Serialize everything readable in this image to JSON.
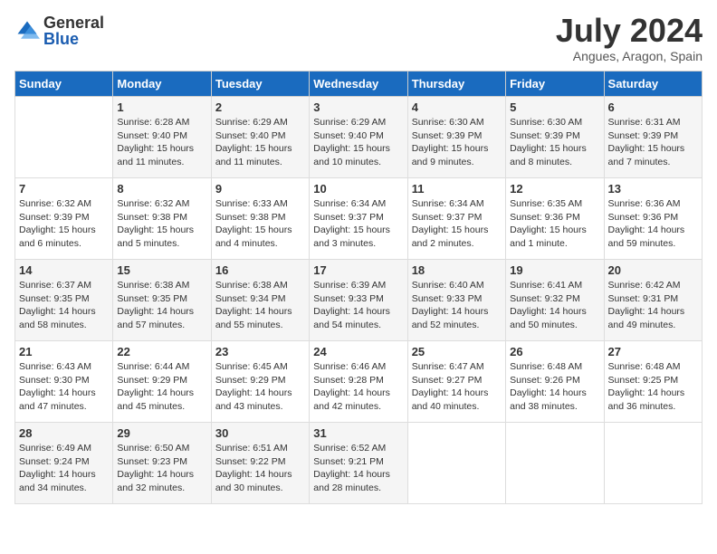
{
  "logo": {
    "general": "General",
    "blue": "Blue"
  },
  "title": "July 2024",
  "location": "Angues, Aragon, Spain",
  "days_of_week": [
    "Sunday",
    "Monday",
    "Tuesday",
    "Wednesday",
    "Thursday",
    "Friday",
    "Saturday"
  ],
  "weeks": [
    [
      {
        "day": "",
        "info": ""
      },
      {
        "day": "1",
        "info": "Sunrise: 6:28 AM\nSunset: 9:40 PM\nDaylight: 15 hours\nand 11 minutes."
      },
      {
        "day": "2",
        "info": "Sunrise: 6:29 AM\nSunset: 9:40 PM\nDaylight: 15 hours\nand 11 minutes."
      },
      {
        "day": "3",
        "info": "Sunrise: 6:29 AM\nSunset: 9:40 PM\nDaylight: 15 hours\nand 10 minutes."
      },
      {
        "day": "4",
        "info": "Sunrise: 6:30 AM\nSunset: 9:39 PM\nDaylight: 15 hours\nand 9 minutes."
      },
      {
        "day": "5",
        "info": "Sunrise: 6:30 AM\nSunset: 9:39 PM\nDaylight: 15 hours\nand 8 minutes."
      },
      {
        "day": "6",
        "info": "Sunrise: 6:31 AM\nSunset: 9:39 PM\nDaylight: 15 hours\nand 7 minutes."
      }
    ],
    [
      {
        "day": "7",
        "info": "Sunrise: 6:32 AM\nSunset: 9:39 PM\nDaylight: 15 hours\nand 6 minutes."
      },
      {
        "day": "8",
        "info": "Sunrise: 6:32 AM\nSunset: 9:38 PM\nDaylight: 15 hours\nand 5 minutes."
      },
      {
        "day": "9",
        "info": "Sunrise: 6:33 AM\nSunset: 9:38 PM\nDaylight: 15 hours\nand 4 minutes."
      },
      {
        "day": "10",
        "info": "Sunrise: 6:34 AM\nSunset: 9:37 PM\nDaylight: 15 hours\nand 3 minutes."
      },
      {
        "day": "11",
        "info": "Sunrise: 6:34 AM\nSunset: 9:37 PM\nDaylight: 15 hours\nand 2 minutes."
      },
      {
        "day": "12",
        "info": "Sunrise: 6:35 AM\nSunset: 9:36 PM\nDaylight: 15 hours\nand 1 minute."
      },
      {
        "day": "13",
        "info": "Sunrise: 6:36 AM\nSunset: 9:36 PM\nDaylight: 14 hours\nand 59 minutes."
      }
    ],
    [
      {
        "day": "14",
        "info": "Sunrise: 6:37 AM\nSunset: 9:35 PM\nDaylight: 14 hours\nand 58 minutes."
      },
      {
        "day": "15",
        "info": "Sunrise: 6:38 AM\nSunset: 9:35 PM\nDaylight: 14 hours\nand 57 minutes."
      },
      {
        "day": "16",
        "info": "Sunrise: 6:38 AM\nSunset: 9:34 PM\nDaylight: 14 hours\nand 55 minutes."
      },
      {
        "day": "17",
        "info": "Sunrise: 6:39 AM\nSunset: 9:33 PM\nDaylight: 14 hours\nand 54 minutes."
      },
      {
        "day": "18",
        "info": "Sunrise: 6:40 AM\nSunset: 9:33 PM\nDaylight: 14 hours\nand 52 minutes."
      },
      {
        "day": "19",
        "info": "Sunrise: 6:41 AM\nSunset: 9:32 PM\nDaylight: 14 hours\nand 50 minutes."
      },
      {
        "day": "20",
        "info": "Sunrise: 6:42 AM\nSunset: 9:31 PM\nDaylight: 14 hours\nand 49 minutes."
      }
    ],
    [
      {
        "day": "21",
        "info": "Sunrise: 6:43 AM\nSunset: 9:30 PM\nDaylight: 14 hours\nand 47 minutes."
      },
      {
        "day": "22",
        "info": "Sunrise: 6:44 AM\nSunset: 9:29 PM\nDaylight: 14 hours\nand 45 minutes."
      },
      {
        "day": "23",
        "info": "Sunrise: 6:45 AM\nSunset: 9:29 PM\nDaylight: 14 hours\nand 43 minutes."
      },
      {
        "day": "24",
        "info": "Sunrise: 6:46 AM\nSunset: 9:28 PM\nDaylight: 14 hours\nand 42 minutes."
      },
      {
        "day": "25",
        "info": "Sunrise: 6:47 AM\nSunset: 9:27 PM\nDaylight: 14 hours\nand 40 minutes."
      },
      {
        "day": "26",
        "info": "Sunrise: 6:48 AM\nSunset: 9:26 PM\nDaylight: 14 hours\nand 38 minutes."
      },
      {
        "day": "27",
        "info": "Sunrise: 6:48 AM\nSunset: 9:25 PM\nDaylight: 14 hours\nand 36 minutes."
      }
    ],
    [
      {
        "day": "28",
        "info": "Sunrise: 6:49 AM\nSunset: 9:24 PM\nDaylight: 14 hours\nand 34 minutes."
      },
      {
        "day": "29",
        "info": "Sunrise: 6:50 AM\nSunset: 9:23 PM\nDaylight: 14 hours\nand 32 minutes."
      },
      {
        "day": "30",
        "info": "Sunrise: 6:51 AM\nSunset: 9:22 PM\nDaylight: 14 hours\nand 30 minutes."
      },
      {
        "day": "31",
        "info": "Sunrise: 6:52 AM\nSunset: 9:21 PM\nDaylight: 14 hours\nand 28 minutes."
      },
      {
        "day": "",
        "info": ""
      },
      {
        "day": "",
        "info": ""
      },
      {
        "day": "",
        "info": ""
      }
    ]
  ]
}
